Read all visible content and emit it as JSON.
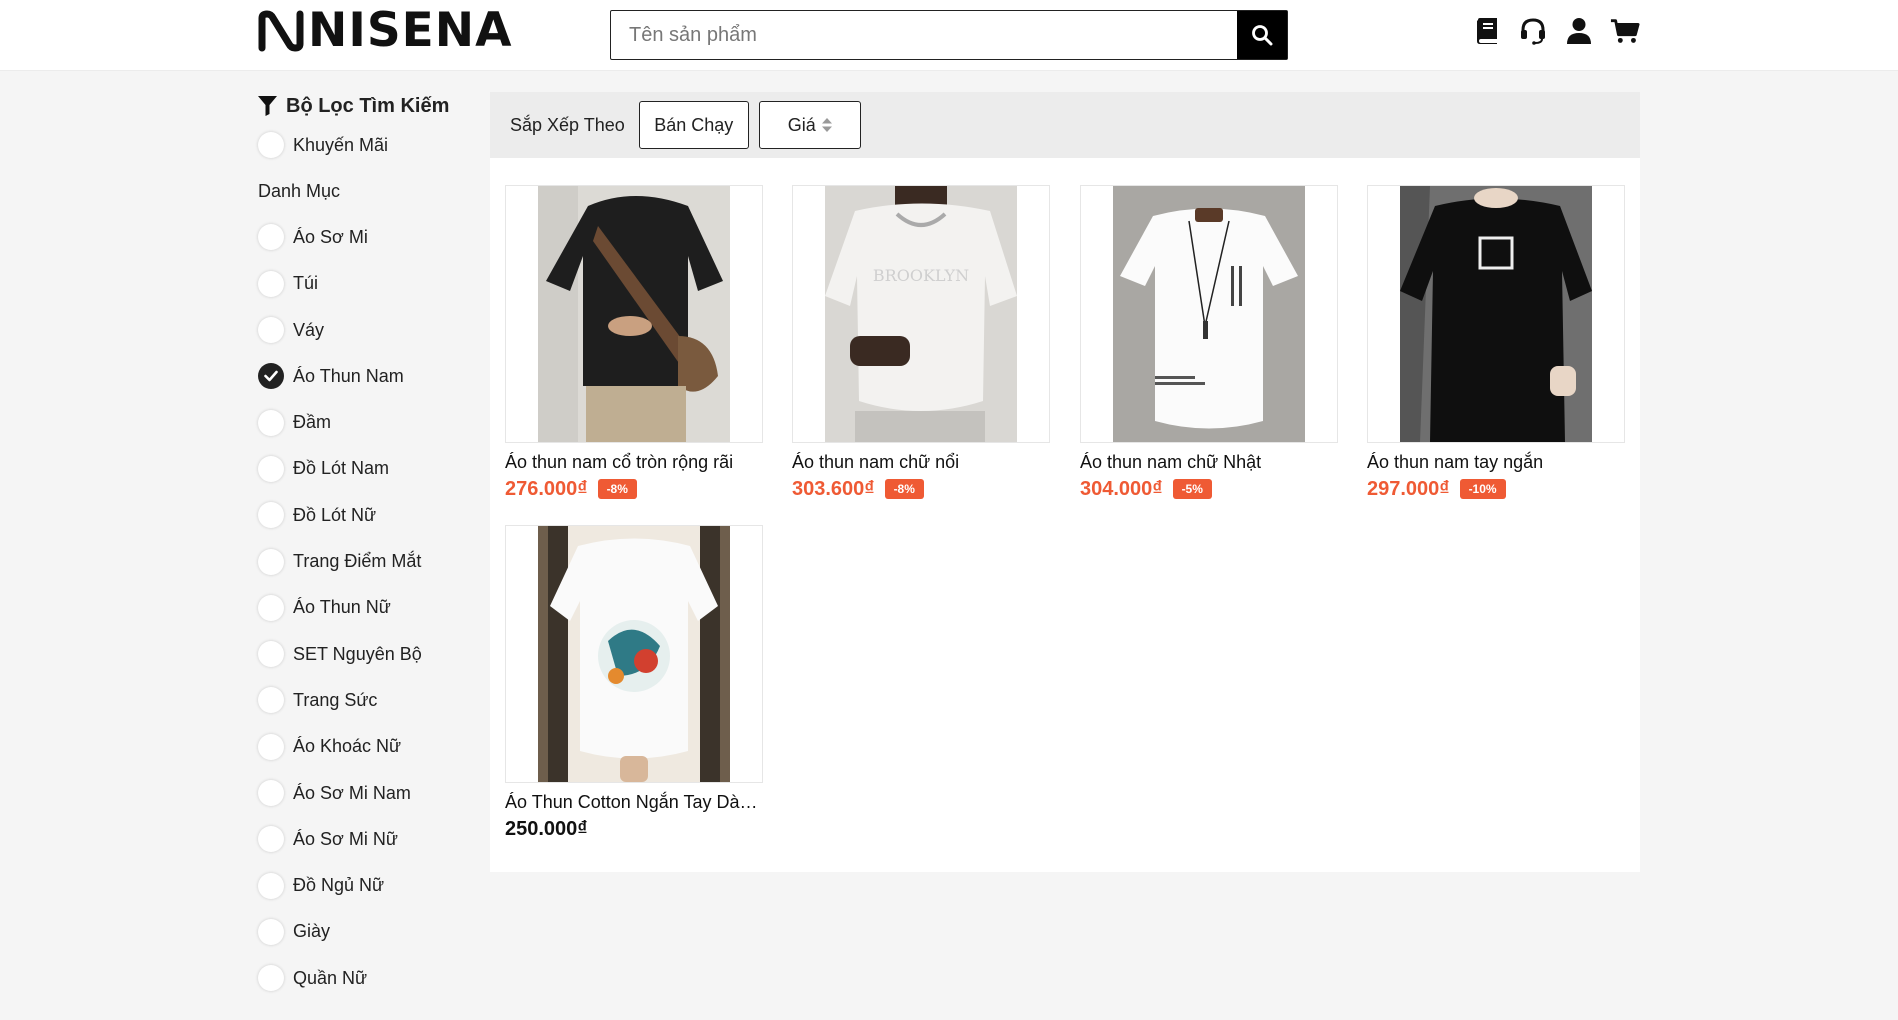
{
  "header": {
    "logo_text": "NISENA",
    "search_placeholder": "Tên sản phẩm",
    "icons": [
      "book-icon",
      "headset-icon",
      "user-icon",
      "cart-icon"
    ]
  },
  "sidebar": {
    "title": "Bộ Lọc Tìm Kiếm",
    "promo_label": "Khuyến Mãi",
    "category_heading": "Danh Mục",
    "categories": [
      {
        "label": "Áo Sơ Mi",
        "checked": false
      },
      {
        "label": "Túi",
        "checked": false
      },
      {
        "label": "Váy",
        "checked": false
      },
      {
        "label": "Áo Thun Nam",
        "checked": true
      },
      {
        "label": "Đầm",
        "checked": false
      },
      {
        "label": "Đồ Lót Nam",
        "checked": false
      },
      {
        "label": "Đồ Lót Nữ",
        "checked": false
      },
      {
        "label": "Trang Điểm Mắt",
        "checked": false
      },
      {
        "label": "Áo Thun Nữ",
        "checked": false
      },
      {
        "label": "SET Nguyên Bộ",
        "checked": false
      },
      {
        "label": "Trang Sức",
        "checked": false
      },
      {
        "label": "Áo Khoác Nữ",
        "checked": false
      },
      {
        "label": "Áo Sơ Mi Nam",
        "checked": false
      },
      {
        "label": "Áo Sơ Mi Nữ",
        "checked": false
      },
      {
        "label": "Đồ Ngủ Nữ",
        "checked": false
      },
      {
        "label": "Giày",
        "checked": false
      },
      {
        "label": "Quần Nữ",
        "checked": false
      }
    ]
  },
  "sort": {
    "label": "Sắp Xếp Theo",
    "best_selling": "Bán Chạy",
    "price": "Giá"
  },
  "products": [
    {
      "name": "Áo thun nam cổ tròn rộng rãi",
      "price": "276.000₫",
      "discount": "-8%"
    },
    {
      "name": "Áo thun nam chữ nổi",
      "price": "303.600₫",
      "discount": "-8%"
    },
    {
      "name": "Áo thun nam chữ Nhật",
      "price": "304.000₫",
      "discount": "-5%"
    },
    {
      "name": "Áo thun nam tay ngắn",
      "price": "297.000₫",
      "discount": "-10%"
    },
    {
      "name": "Áo Thun Cotton Ngắn Tay Dàn...",
      "price": "250.000₫",
      "discount": ""
    }
  ],
  "colors": {
    "accent": "#ef5a34",
    "dark": "#111111"
  }
}
